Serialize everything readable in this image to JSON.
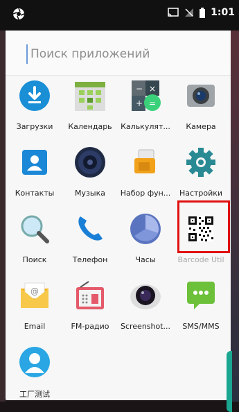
{
  "status": {
    "time": "1:01"
  },
  "search": {
    "placeholder": "Поиск приложений"
  },
  "apps": [
    {
      "label": "Загрузки",
      "icon": "download-icon"
    },
    {
      "label": "Календарь",
      "icon": "calendar-icon"
    },
    {
      "label": "Калькулят...",
      "icon": "calculator-icon"
    },
    {
      "label": "Камера",
      "icon": "camera-icon"
    },
    {
      "label": "Контакты",
      "icon": "contacts-icon"
    },
    {
      "label": "Музыка",
      "icon": "music-icon"
    },
    {
      "label": "Набор фун...",
      "icon": "sim-toolkit-icon"
    },
    {
      "label": "Настройки",
      "icon": "settings-gear-icon"
    },
    {
      "label": "Поиск",
      "icon": "search-magnifier-icon"
    },
    {
      "label": "Телефон",
      "icon": "phone-icon"
    },
    {
      "label": "Часы",
      "icon": "clock-icon"
    },
    {
      "label": "Barcode Util",
      "icon": "qr-code-icon"
    },
    {
      "label": "Email",
      "icon": "email-icon"
    },
    {
      "label": "FM-радио",
      "icon": "fm-radio-icon"
    },
    {
      "label": "Screenshot...",
      "icon": "screenshot-icon"
    },
    {
      "label": "SMS/MMS",
      "icon": "sms-icon"
    },
    {
      "label": "工厂测试",
      "icon": "factory-test-icon"
    }
  ]
}
